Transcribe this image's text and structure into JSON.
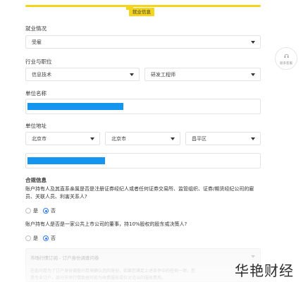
{
  "progress": {
    "step_label": "就业信息",
    "accent": "#f5d51b"
  },
  "customer_service": {
    "label": "联系客服",
    "icon": "headset-icon"
  },
  "employment": {
    "label": "就业情况",
    "value": "受雇"
  },
  "industry": {
    "label": "行业与职位",
    "industry_value": "信息技术",
    "position_value": "研发工程师"
  },
  "company_name": {
    "label": "单位名称"
  },
  "company_address": {
    "label": "单位地址",
    "province": "北京市",
    "city": "北京市",
    "district": "昌平区"
  },
  "compliance": {
    "title": "合规信息",
    "q1": "账户持有人及其直系亲属是否是注册证券经纪人或者任何证券交易所、监管组织、证券/期货经纪公司的雇员、关联人员、利害关系人?",
    "q2": "账户持有人是否是一家公共上市公司的董事，持10%股权的股东或决策人?",
    "yes": "是",
    "no": "否",
    "q1_answer": "否",
    "q2_answer": "否"
  },
  "subscription": {
    "title": "市场行情订阅 - 订户身份调查问卷",
    "desc1": "在此问卷为了订户身份调查问卷来确认您的身份，如果您满足上述条件中的任何一项，您",
    "desc2": "是专业订户，部分市场行情数据可能为收费服务或仅对适当的服务费用。"
  },
  "watermark": "华艳财经",
  "accent_blue": "#2f7bf5",
  "redaction_color": "#1496f0"
}
